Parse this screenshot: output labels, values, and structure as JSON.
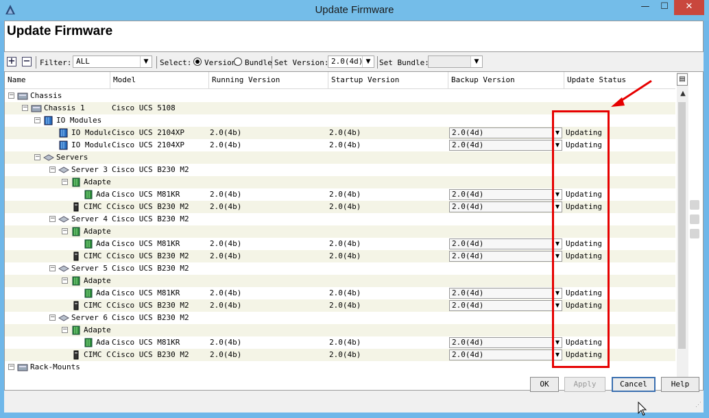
{
  "window": {
    "title": "Update Firmware",
    "controls": {
      "minimize": "—",
      "maximize": "☐",
      "close": "✕"
    }
  },
  "header": {
    "title": "Update Firmware"
  },
  "toolbar": {
    "expand": "+",
    "collapse": "−",
    "filter_label": "Filter:",
    "filter_value": "ALL",
    "select_label": "Select:",
    "radio_version": "Version",
    "radio_bundle": "Bundle",
    "set_version_label": "Set Version:",
    "set_version_value": "2.0(4d)",
    "set_bundle_label": "Set Bundle:",
    "set_bundle_value": ""
  },
  "columns": [
    "Name",
    "Model",
    "Running Version",
    "Startup Version",
    "Backup Version",
    "Update Status"
  ],
  "rows": [
    {
      "name": "Chassis",
      "model": "",
      "running": "",
      "startup": "",
      "backup": "",
      "status": ""
    },
    {
      "name": "Chassis 1",
      "model": "Cisco UCS 5108",
      "running": "",
      "startup": "",
      "backup": "",
      "status": ""
    },
    {
      "name": "IO Modules",
      "model": "",
      "running": "",
      "startup": "",
      "backup": "",
      "status": ""
    },
    {
      "name": "IO Module",
      "model": "Cisco UCS 2104XP",
      "running": "2.0(4b)",
      "startup": "2.0(4b)",
      "backup": "2.0(4d)",
      "status": "Updating"
    },
    {
      "name": "IO Module",
      "model": "Cisco UCS 2104XP",
      "running": "2.0(4b)",
      "startup": "2.0(4b)",
      "backup": "2.0(4d)",
      "status": "Updating"
    },
    {
      "name": "Servers",
      "model": "",
      "running": "",
      "startup": "",
      "backup": "",
      "status": ""
    },
    {
      "name": "Server 3",
      "model": "Cisco UCS B230 M2",
      "running": "",
      "startup": "",
      "backup": "",
      "status": ""
    },
    {
      "name": "Adapte",
      "model": "",
      "running": "",
      "startup": "",
      "backup": "",
      "status": ""
    },
    {
      "name": "Ada",
      "model": "Cisco UCS M81KR",
      "running": "2.0(4b)",
      "startup": "2.0(4b)",
      "backup": "2.0(4d)",
      "status": "Updating"
    },
    {
      "name": "CIMC C",
      "model": "Cisco UCS B230 M2",
      "running": "2.0(4b)",
      "startup": "2.0(4b)",
      "backup": "2.0(4d)",
      "status": "Updating"
    },
    {
      "name": "Server 4",
      "model": "Cisco UCS B230 M2",
      "running": "",
      "startup": "",
      "backup": "",
      "status": ""
    },
    {
      "name": "Adapte",
      "model": "",
      "running": "",
      "startup": "",
      "backup": "",
      "status": ""
    },
    {
      "name": "Ada",
      "model": "Cisco UCS M81KR",
      "running": "2.0(4b)",
      "startup": "2.0(4b)",
      "backup": "2.0(4d)",
      "status": "Updating"
    },
    {
      "name": "CIMC C",
      "model": "Cisco UCS B230 M2",
      "running": "2.0(4b)",
      "startup": "2.0(4b)",
      "backup": "2.0(4d)",
      "status": "Updating"
    },
    {
      "name": "Server 5",
      "model": "Cisco UCS B230 M2",
      "running": "",
      "startup": "",
      "backup": "",
      "status": ""
    },
    {
      "name": "Adapte",
      "model": "",
      "running": "",
      "startup": "",
      "backup": "",
      "status": ""
    },
    {
      "name": "Ada",
      "model": "Cisco UCS M81KR",
      "running": "2.0(4b)",
      "startup": "2.0(4b)",
      "backup": "2.0(4d)",
      "status": "Updating"
    },
    {
      "name": "CIMC C",
      "model": "Cisco UCS B230 M2",
      "running": "2.0(4b)",
      "startup": "2.0(4b)",
      "backup": "2.0(4d)",
      "status": "Updating"
    },
    {
      "name": "Server 6",
      "model": "Cisco UCS B230 M2",
      "running": "",
      "startup": "",
      "backup": "",
      "status": ""
    },
    {
      "name": "Adapte",
      "model": "",
      "running": "",
      "startup": "",
      "backup": "",
      "status": ""
    },
    {
      "name": "Ada",
      "model": "Cisco UCS M81KR",
      "running": "2.0(4b)",
      "startup": "2.0(4b)",
      "backup": "2.0(4d)",
      "status": "Updating"
    },
    {
      "name": "CIMC C",
      "model": "Cisco UCS B230 M2",
      "running": "2.0(4b)",
      "startup": "2.0(4b)",
      "backup": "2.0(4d)",
      "status": "Updating"
    },
    {
      "name": "Rack-Mounts",
      "model": "",
      "running": "",
      "startup": "",
      "backup": "",
      "status": ""
    }
  ],
  "footer": {
    "ok": "OK",
    "apply": "Apply",
    "cancel": "Cancel",
    "help": "Help"
  },
  "colors": {
    "titlebar": "#74bde9",
    "close": "#c9473d",
    "highlight": "#e60000",
    "row_alt": "#f4f4e6"
  }
}
